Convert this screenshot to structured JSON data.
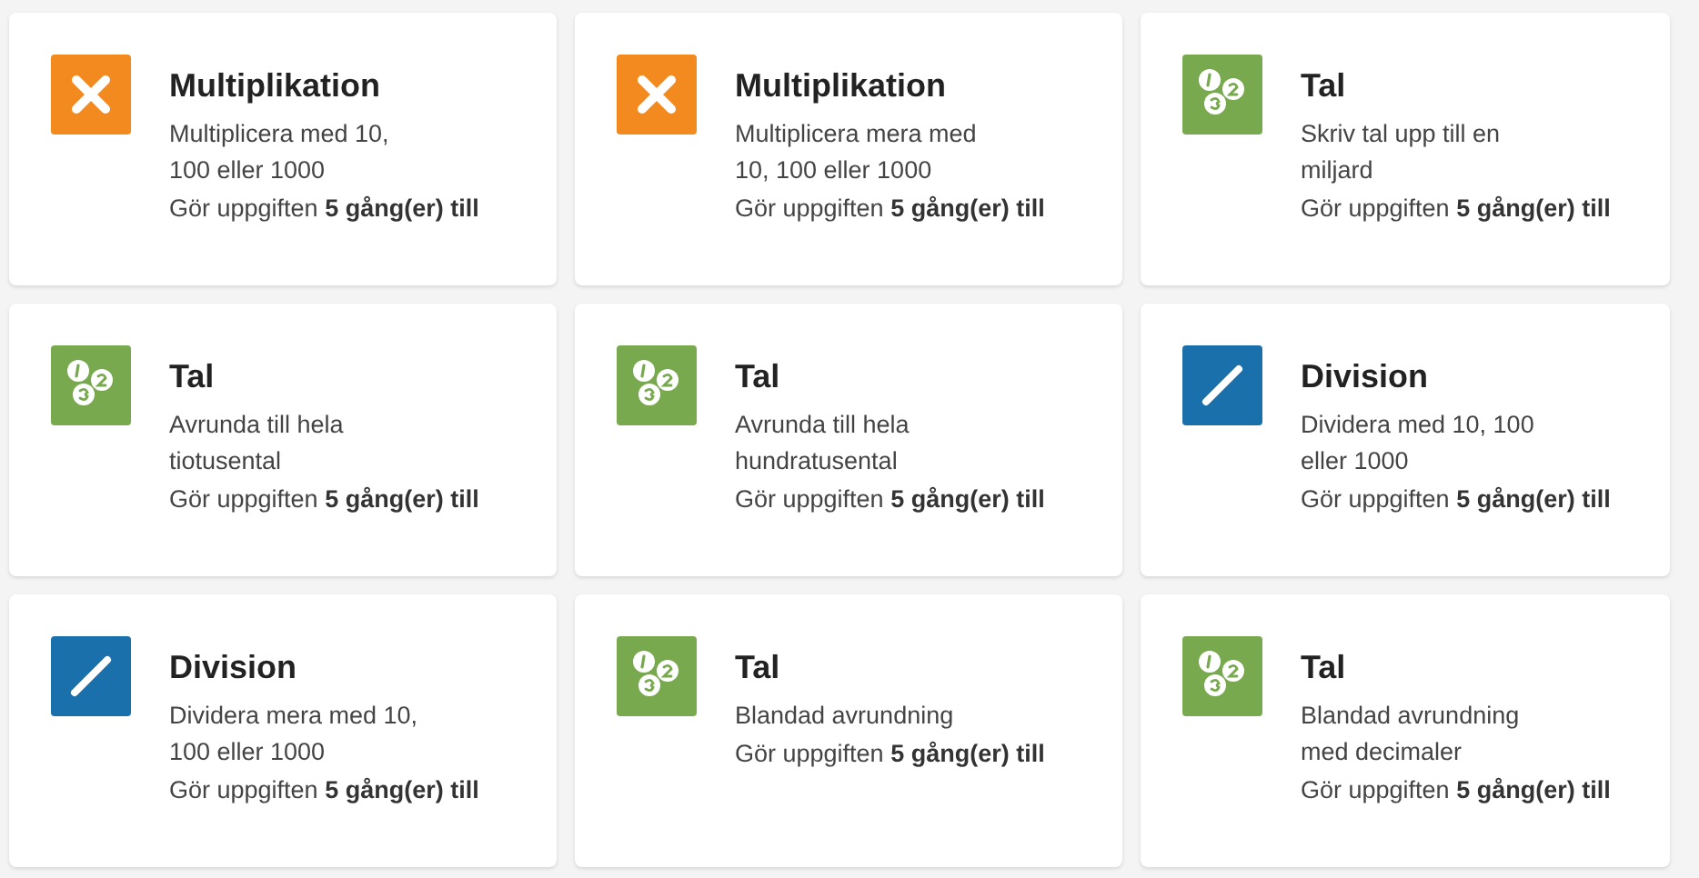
{
  "cards": [
    {
      "kind": "multiply",
      "title": "Multiplikation",
      "description": "Multiplicera med 10,\n100 eller 1000",
      "progress": "Gör uppgiften **5 gång(er) till**"
    },
    {
      "kind": "multiply",
      "title": "Multiplikation",
      "description": "Multiplicera mera med\n10, 100 eller 1000",
      "progress": "Gör uppgiften **5 gång(er) till**"
    },
    {
      "kind": "numbers",
      "title": "Tal",
      "description": "Skriv tal upp till en\nmiljard",
      "progress": "Gör uppgiften **5 gång(er) till**"
    },
    {
      "kind": "numbers",
      "title": "Tal",
      "description": "Avrunda till hela\ntiotusental",
      "progress": "Gör uppgiften **5 gång(er) till**"
    },
    {
      "kind": "numbers",
      "title": "Tal",
      "description": "Avrunda till hela\nhundratusental",
      "progress": "Gör uppgiften **5 gång(er) till**"
    },
    {
      "kind": "divide",
      "title": "Division",
      "description": "Dividera med 10, 100\neller 1000",
      "progress": "Gör uppgiften **5 gång(er) till**"
    },
    {
      "kind": "divide",
      "title": "Division",
      "description": "Dividera mera med 10,\n100 eller 1000",
      "progress": "Gör uppgiften **5 gång(er) till**"
    },
    {
      "kind": "numbers",
      "title": "Tal",
      "description": "Blandad avrundning",
      "progress": "Gör uppgiften **5 gång(er) till**"
    },
    {
      "kind": "numbers",
      "title": "Tal",
      "description": "Blandad avrundning\nmed decimaler",
      "progress": "Gör uppgiften **5 gång(er) till**"
    }
  ]
}
